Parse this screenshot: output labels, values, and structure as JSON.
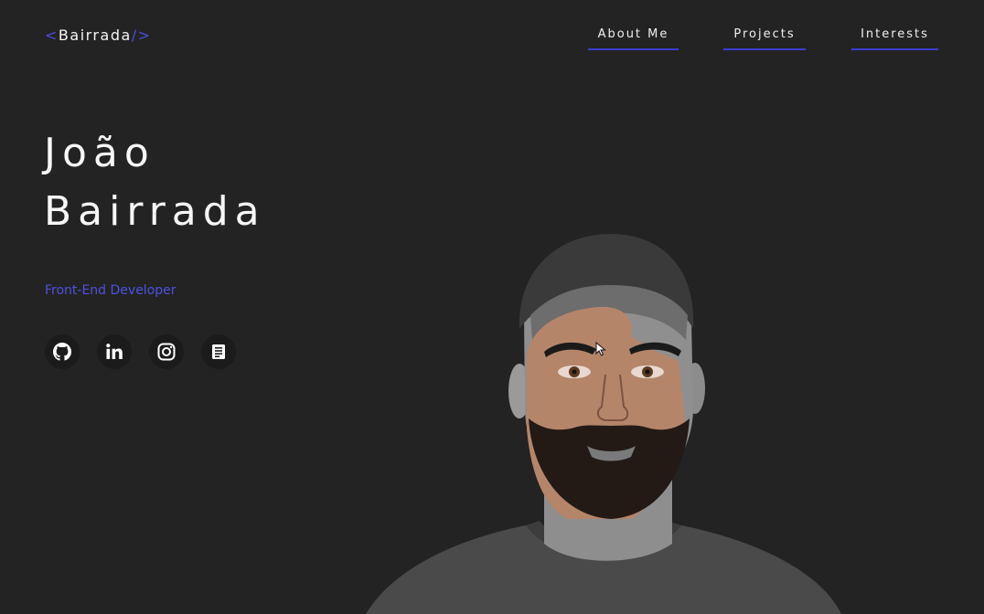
{
  "header": {
    "logo": {
      "open_bracket": "<",
      "name": "Bairrada",
      "close_bracket": "/>"
    },
    "nav": [
      {
        "label": "About Me"
      },
      {
        "label": "Projects"
      },
      {
        "label": "Interests"
      }
    ]
  },
  "hero": {
    "first_name": "João",
    "last_name": "Bairrada",
    "role": "Front-End Developer",
    "socials": [
      {
        "icon": "github-icon"
      },
      {
        "icon": "linkedin-icon"
      },
      {
        "icon": "instagram-icon"
      },
      {
        "icon": "resume-icon"
      }
    ]
  },
  "colors": {
    "background": "#232323",
    "accent": "#4a4fd8",
    "text": "#f3f3f3",
    "icon_bg": "#1b1b1b"
  }
}
